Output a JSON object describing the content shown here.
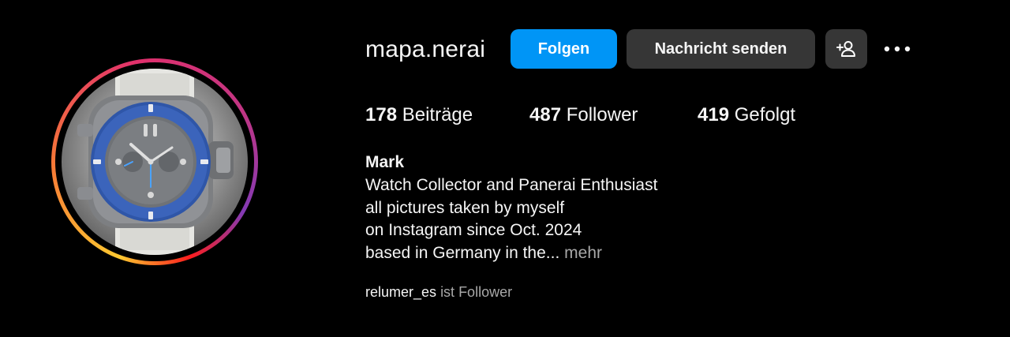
{
  "profile": {
    "username": "mapa.nerai",
    "avatar_icon": "wristwatch-photo"
  },
  "actions": {
    "follow_label": "Folgen",
    "message_label": "Nachricht senden",
    "suggest_icon": "add-person-icon",
    "more_icon": "more-options-icon"
  },
  "stats": {
    "posts_count": "178",
    "posts_label": "Beiträge",
    "followers_count": "487",
    "followers_label": "Follower",
    "following_count": "419",
    "following_label": "Gefolgt"
  },
  "bio": {
    "name": "Mark",
    "lines": [
      "Watch Collector and Panerai Enthusiast",
      "all pictures taken by myself",
      "on Instagram since Oct. 2024",
      "based in Germany in the..."
    ],
    "more_label": "mehr"
  },
  "followed_by": {
    "user": "relumer_es",
    "text": "ist Follower"
  },
  "colors": {
    "background": "#000000",
    "primary_button": "#0095f6",
    "secondary_button": "#363636",
    "muted_text": "#a8a8a8"
  }
}
